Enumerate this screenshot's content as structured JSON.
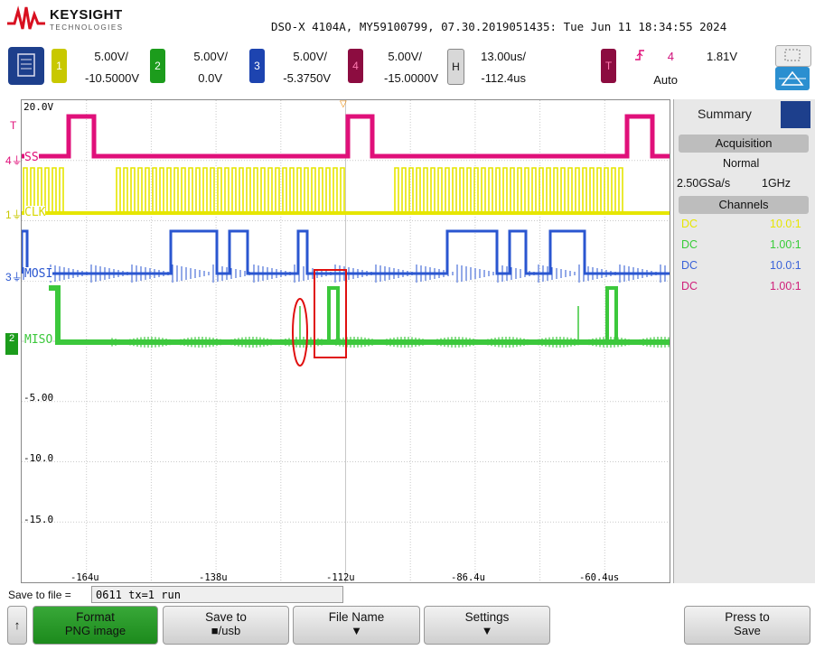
{
  "header": {
    "brand": "KEYSIGHT",
    "brand_sub": "TECHNOLOGIES",
    "info": "DSO-X 4104A, MY59100799, 07.30.2019051435: Tue Jun 11 18:34:55 2024"
  },
  "channels": [
    {
      "num": "1",
      "scale": "5.00V/",
      "offset": "-10.5000V",
      "color": "#d8d800"
    },
    {
      "num": "2",
      "scale": "5.00V/",
      "offset": "0.0V",
      "color": "#22b022"
    },
    {
      "num": "3",
      "scale": "5.00V/",
      "offset": "-5.3750V",
      "color": "#2050c8"
    },
    {
      "num": "4",
      "scale": "5.00V/",
      "offset": "-15.0000V",
      "color": "#a0104a"
    }
  ],
  "horizontal": {
    "label": "H",
    "scale": "13.00us/",
    "delay": "-112.4us"
  },
  "trigger": {
    "label": "T",
    "source": "4",
    "level": "1.81V",
    "mode": "Auto"
  },
  "screen": {
    "y_labels": [
      "20.0V",
      "-5.00",
      "-10.0",
      "-15.0"
    ],
    "x_labels": [
      "-164u",
      "-138u",
      "-112u",
      "-86.4u",
      "-60.4us"
    ],
    "trace_labels": {
      "ss": "SS",
      "clk": "CLK",
      "mosi": "MOSI",
      "miso": "MISO"
    },
    "marker_t": "T"
  },
  "sidebar": {
    "tab": "Summary",
    "acq_header": "Acquisition",
    "acq_mode": "Normal",
    "sample_rate": "2.50GSa/s",
    "bandwidth": "1GHz",
    "channels_header": "Channels",
    "rows": [
      {
        "coupling": "DC",
        "probe": "10.0:1",
        "color": "#e6e600"
      },
      {
        "coupling": "DC",
        "probe": "1.00:1",
        "color": "#38cc38"
      },
      {
        "coupling": "DC",
        "probe": "10.0:1",
        "color": "#3a62d8"
      },
      {
        "coupling": "DC",
        "probe": "1.00:1",
        "color": "#d0207a"
      }
    ]
  },
  "bottom": {
    "save_label": "Save to file =",
    "save_value": "0611 tx=1 run",
    "softkeys": [
      {
        "l1": "Format",
        "l2": "PNG image"
      },
      {
        "l1": "Save to",
        "l2": "■/usb"
      },
      {
        "l1": "File Name",
        "l2": ""
      },
      {
        "l1": "Settings",
        "l2": ""
      },
      {
        "l1": "Press to",
        "l2": "Save"
      }
    ]
  },
  "colors": {
    "ss": "#e0107a",
    "clk": "#e6e600",
    "mosi": "#2a56d0",
    "miso": "#3cc83c",
    "annotation": "#e01010"
  }
}
